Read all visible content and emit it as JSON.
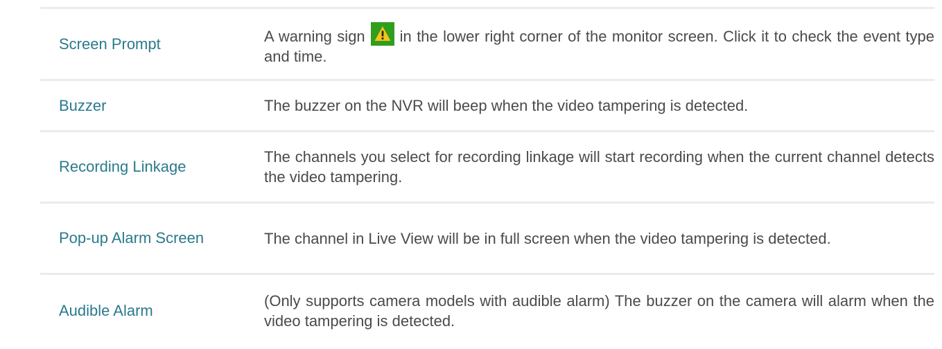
{
  "rows": [
    {
      "label": "Screen Prompt",
      "desc_before": "A warning sign",
      "icon": "warning-icon",
      "desc_after": "in the lower right corner of the monitor screen. Click it to check the event type and time."
    },
    {
      "label": "Buzzer",
      "desc": "The buzzer on the NVR will beep when the video tampering is detected."
    },
    {
      "label": "Recording Linkage",
      "desc": "The channels you select for recording linkage will start recording when the current channel detects the video tampering."
    },
    {
      "label": "Pop-up Alarm Screen",
      "desc": "The channel in Live View will be in full screen when the video tampering is detected."
    },
    {
      "label": "Audible Alarm",
      "desc": "(Only supports camera models with audible alarm) The buzzer on the camera will alarm when the video tampering is detected."
    }
  ],
  "colors": {
    "label": "#2a7a8c",
    "text": "#4a4a4a",
    "rule": "#e9ecef",
    "icon_bg": "#2f9e1f",
    "icon_triangle": "#f6c21a"
  }
}
